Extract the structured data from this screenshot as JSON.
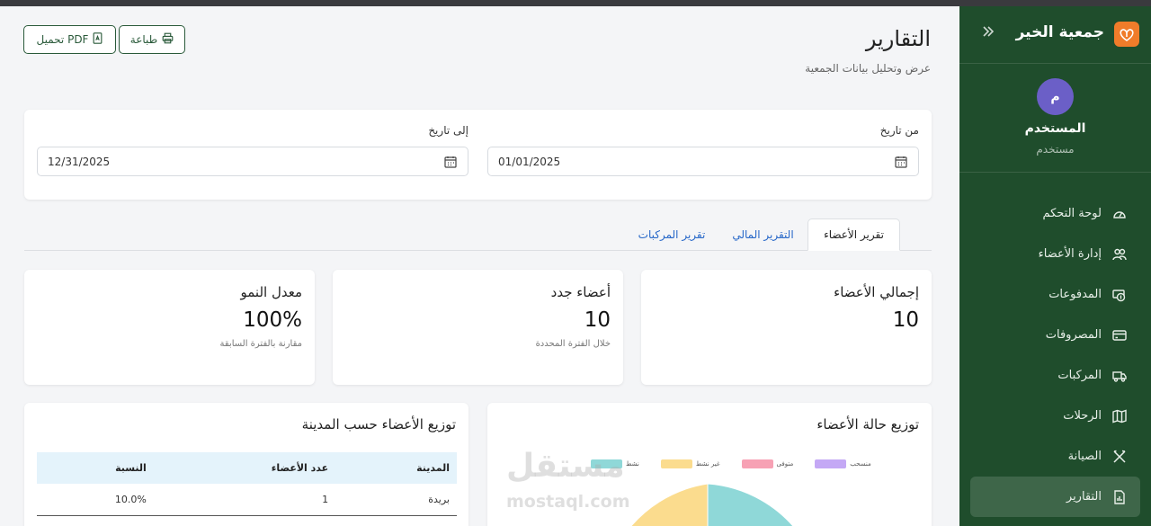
{
  "app": {
    "brand": "جمعية الخير"
  },
  "user": {
    "initial": "م",
    "name": "المستخدم",
    "role": "مستخدم"
  },
  "nav": [
    {
      "label": "لوحة التحكم",
      "icon": "gauge-icon",
      "active": false
    },
    {
      "label": "إدارة الأعضاء",
      "icon": "users-icon",
      "active": false
    },
    {
      "label": "المدفوعات",
      "icon": "money-icon",
      "active": false
    },
    {
      "label": "المصروفات",
      "icon": "credit-card-icon",
      "active": false
    },
    {
      "label": "المركبات",
      "icon": "truck-icon",
      "active": false
    },
    {
      "label": "الرحلات",
      "icon": "map-icon",
      "active": false
    },
    {
      "label": "الصيانة",
      "icon": "tools-icon",
      "active": false
    },
    {
      "label": "التقارير",
      "icon": "report-icon",
      "active": true
    }
  ],
  "header": {
    "title": "التقارير",
    "subtitle": "عرض وتحليل بيانات الجمعية",
    "print_label": "طباعة",
    "pdf_label": "تحميل PDF"
  },
  "filters": {
    "from_label": "من تاريخ",
    "from_value": "01/01/2025",
    "to_label": "إلى تاريخ",
    "to_value": "12/31/2025"
  },
  "tabs": [
    {
      "label": "تقرير الأعضاء",
      "active": true
    },
    {
      "label": "التقرير المالي",
      "active": false
    },
    {
      "label": "تقرير المركبات",
      "active": false
    }
  ],
  "stats": [
    {
      "title": "إجمالي الأعضاء",
      "value": "10",
      "note": ""
    },
    {
      "title": "أعضاء جدد",
      "value": "10",
      "note": "خلال الفترة المحددة"
    },
    {
      "title": "معدل النمو",
      "value": "100%",
      "note": "مقارنة بالفترة السابقة"
    }
  ],
  "status_chart": {
    "title": "توزيع حالة الأعضاء",
    "legend": [
      {
        "label": "نشط",
        "color": "#8fd8d8"
      },
      {
        "label": "غير نشط",
        "color": "#fbdc8e"
      },
      {
        "label": "متوفى",
        "color": "#f7a1b4"
      },
      {
        "label": "منسحب",
        "color": "#c4a8f5"
      }
    ]
  },
  "city_table": {
    "title": "توزيع الأعضاء حسب المدينة",
    "headers": [
      "المدينة",
      "عدد الأعضاء",
      "النسبة"
    ],
    "rows": [
      {
        "city": "بريدة",
        "count": "1",
        "percent": "10.0%"
      }
    ]
  },
  "watermark": {
    "line1": "مستقل",
    "line2": "mostaql.com"
  },
  "colors": {
    "sidebar": "#1f4d2c",
    "accent": "#2a5a3a",
    "link": "#2667c8",
    "logo": "#f07c2a"
  }
}
